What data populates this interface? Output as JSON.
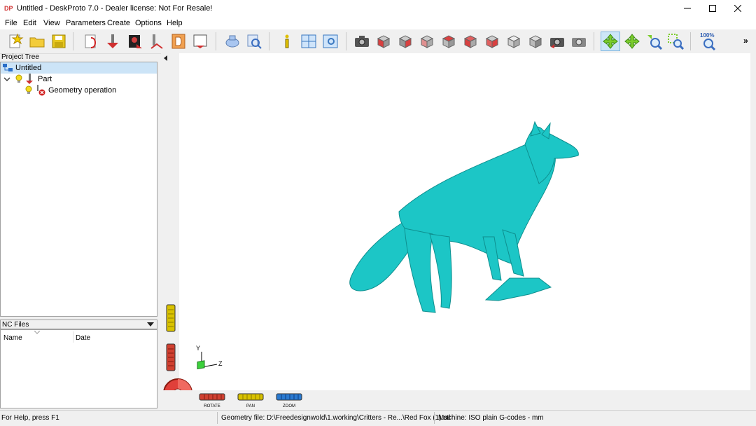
{
  "window": {
    "title": "Untitled - DeskProto 7.0 - Dealer license: Not For Resale!",
    "app_icon": "DP"
  },
  "menu": [
    "File",
    "Edit",
    "View",
    "Parameters",
    "Create",
    "Options",
    "Help"
  ],
  "toolbar": {
    "zoom_label": "100%",
    "overflow": "»",
    "buttons": [
      "new-file-icon",
      "open-folder-icon",
      "save-icon",
      "part-params-icon",
      "import-geometry-icon",
      "bitmap-icon",
      "operation-icon",
      "drawing-d-icon",
      "export-icon",
      "toolpath-icon",
      "preview-icon",
      "info-icon",
      "split-view-icon",
      "screen-view-icon",
      "camera-icon",
      "cube-front-icon",
      "cube-right-icon",
      "cube-left-icon",
      "cube-back-icon",
      "cube-top-icon",
      "cube-bottom-icon",
      "cube-iso-icon",
      "cube-shaded-icon",
      "camera-rotate-icon",
      "camera-restore-icon",
      "rotate-mode-icon",
      "pan-mode-icon",
      "zoom-mode-icon",
      "zoom-window-icon",
      "zoom-fit-icon"
    ]
  },
  "project_tree": {
    "title": "Project Tree",
    "root": "Untitled",
    "part": "Part",
    "operation": "Geometry operation"
  },
  "nc_files": {
    "title": "NC Files",
    "columns": [
      "Name",
      "Date"
    ]
  },
  "viewport": {
    "model_color": "#1cc6c6",
    "axes": {
      "y": "Y",
      "z": "Z"
    },
    "controls": [
      "ROTATE",
      "PAN",
      "ZOOM"
    ]
  },
  "status": {
    "help": "For Help, press F1",
    "geometry": "Geometry file: D:\\Freedesignwold\\1.working\\Critters - Re...\\Red Fox (1).stl",
    "machine": "Machine: ISO plain G-codes - mm"
  }
}
